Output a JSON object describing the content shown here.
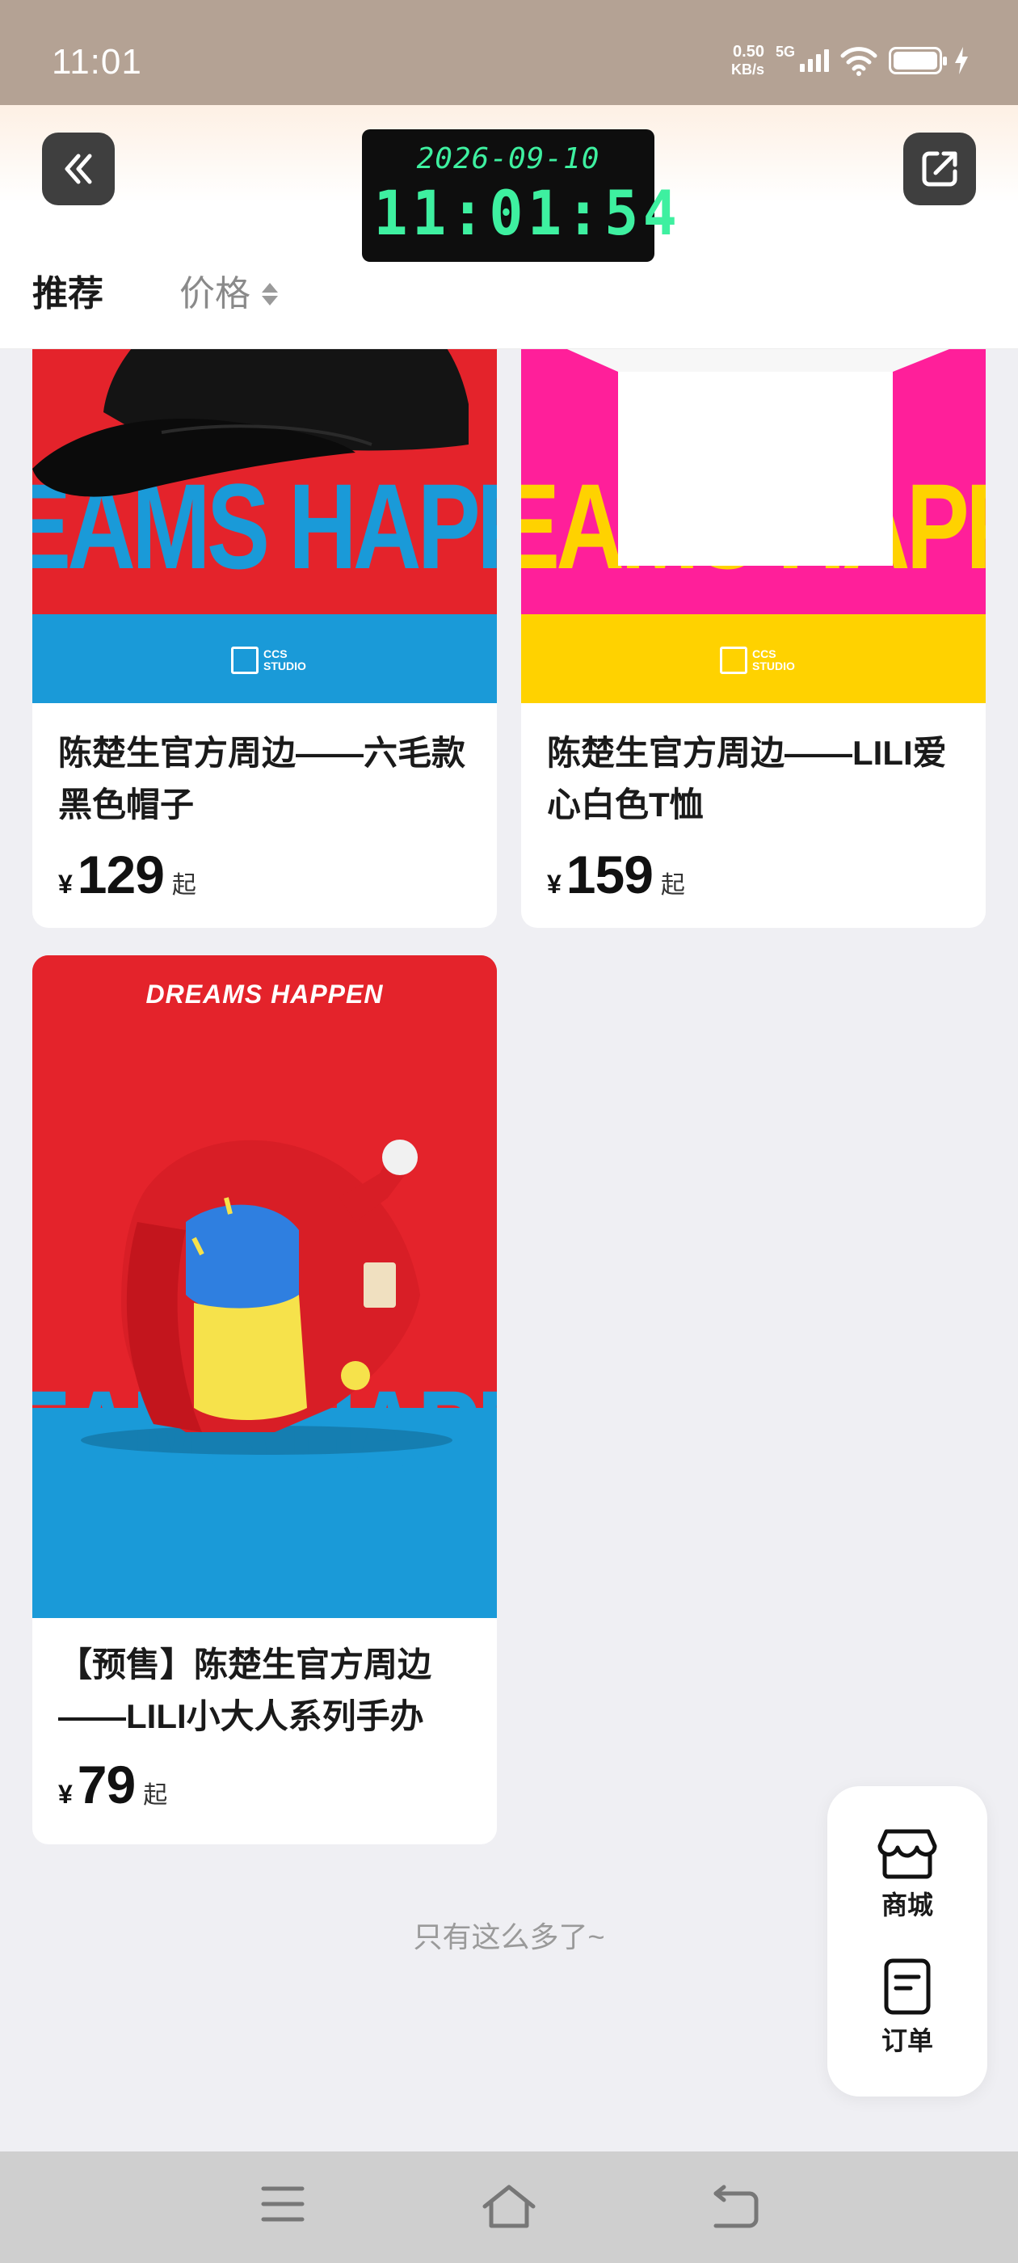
{
  "status_bar": {
    "time": "11:01",
    "net_speed_value": "0.50",
    "net_speed_unit": "KB/s",
    "network": "5G"
  },
  "header": {
    "clock_date": "2026-09-10",
    "clock_time": "11:01:54",
    "tabs": [
      {
        "label": "推荐"
      },
      {
        "label": "价格"
      }
    ]
  },
  "products": [
    {
      "title": "陈楚生官方周边——六毛款黑色帽子",
      "price_symbol": "¥",
      "price": "129",
      "price_suffix": "起",
      "image_text": "EAMS HAPP",
      "logo_text_1": "CCS",
      "logo_text_2": "STUDIO"
    },
    {
      "title": "陈楚生官方周边——LILI爱心白色T恤",
      "price_symbol": "¥",
      "price": "159",
      "price_suffix": "起",
      "image_text": "EAMS HAPP",
      "logo_text_1": "CCS",
      "logo_text_2": "STUDIO"
    },
    {
      "title": "【预售】陈楚生官方周边——LILI小大人系列手办",
      "price_symbol": "¥",
      "price": "79",
      "price_suffix": "起",
      "image_text": "EAMS HAPP",
      "banner_text": "DREAMS HAPPEN"
    }
  ],
  "end_text": "只有这么多了~",
  "float_menu": {
    "shop_label": "商城",
    "orders_label": "订单"
  },
  "colors": {
    "red": "#e4232b",
    "blue": "#1a9ad8",
    "pink": "#ff1f9a",
    "yellow": "#ffd200",
    "clock_green": "#3ef0a0"
  }
}
